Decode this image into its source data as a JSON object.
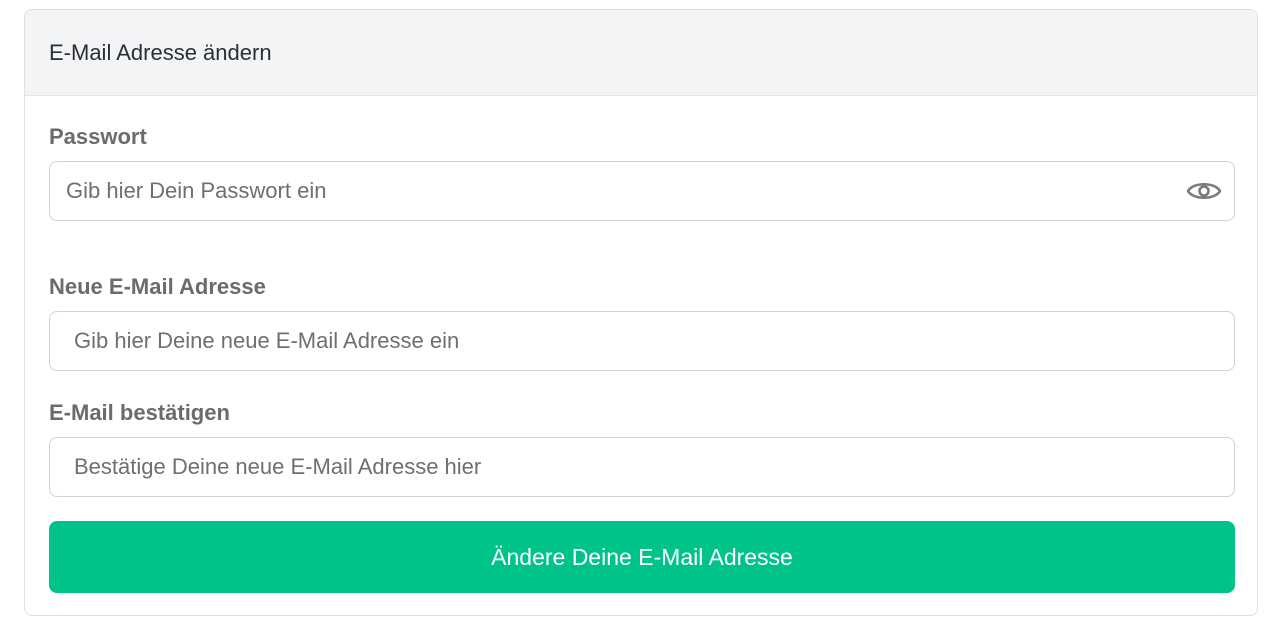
{
  "card": {
    "title": "E-Mail Adresse ändern"
  },
  "password": {
    "label": "Passwort",
    "placeholder": "Gib hier Dein Passwort ein",
    "value": "",
    "toggle_icon": "eye-icon"
  },
  "new_email": {
    "label": "Neue E-Mail Adresse",
    "placeholder": "Gib hier Deine neue E-Mail Adresse ein",
    "value": ""
  },
  "confirm_email": {
    "label": "E-Mail bestätigen",
    "placeholder": "Bestätige Deine neue E-Mail Adresse hier",
    "value": ""
  },
  "submit": {
    "label": "Ändere Deine E-Mail Adresse"
  },
  "colors": {
    "accent": "#00c389",
    "header_bg": "#f3f4f6",
    "label_text": "#6b6b6b",
    "border": "#cfd3d8"
  }
}
